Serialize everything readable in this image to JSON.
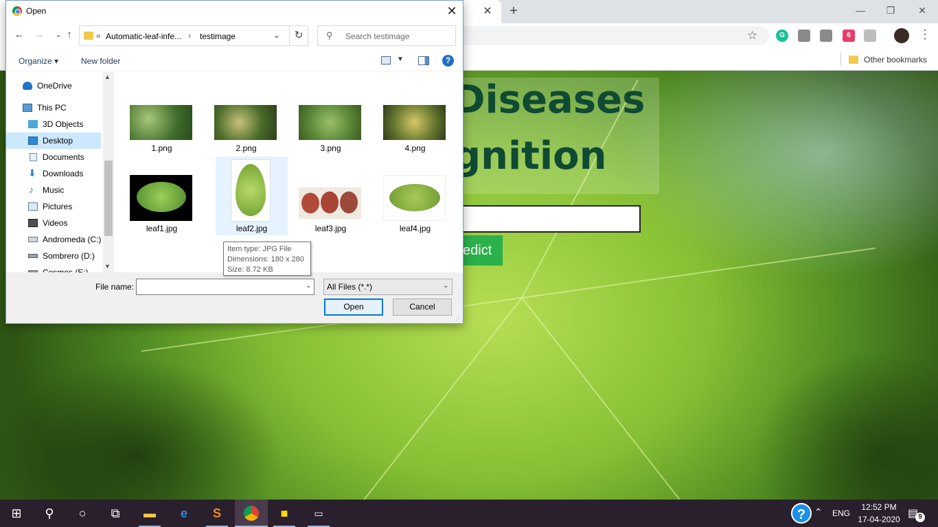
{
  "browser": {
    "tab_close": "✕",
    "new_tab": "+",
    "window_controls": {
      "minimize": "—",
      "restore": "❐",
      "close": "✕"
    },
    "extensions": [
      "G",
      "6"
    ],
    "other_bookmarks": "Other bookmarks"
  },
  "page": {
    "title_line1": "Diseases",
    "title_line2": "gnition",
    "predict_button": "edict"
  },
  "dialog": {
    "title": "Open",
    "close": "✕",
    "address": {
      "chevron": "«",
      "segment1": "Automatic-leaf-infe...",
      "separator": "›",
      "segment2": "testimage"
    },
    "search_placeholder": "Search testimage",
    "command_bar": {
      "organize": "Organize ▾",
      "new_folder": "New folder"
    },
    "nav_items": [
      {
        "label": "OneDrive",
        "icon": "onedrive-icon"
      },
      {
        "label": "This PC",
        "icon": "this-pc-icon"
      },
      {
        "label": "3D Objects",
        "icon": "3d-objects-icon"
      },
      {
        "label": "Desktop",
        "icon": "desktop-icon",
        "selected": true
      },
      {
        "label": "Documents",
        "icon": "documents-icon"
      },
      {
        "label": "Downloads",
        "icon": "downloads-icon"
      },
      {
        "label": "Music",
        "icon": "music-icon"
      },
      {
        "label": "Pictures",
        "icon": "pictures-icon"
      },
      {
        "label": "Videos",
        "icon": "videos-icon"
      },
      {
        "label": "Andromeda (C:)",
        "icon": "drive-c-icon"
      },
      {
        "label": "Sombrero (D:)",
        "icon": "drive-d-icon"
      },
      {
        "label": "Cosmos (E:)",
        "icon": "drive-e-icon"
      }
    ],
    "files": [
      {
        "name": "1.png"
      },
      {
        "name": "2.png"
      },
      {
        "name": "3.png"
      },
      {
        "name": "4.png"
      },
      {
        "name": "leaf1.jpg"
      },
      {
        "name": "leaf2.jpg",
        "hovered": true
      },
      {
        "name": "leaf3.jpg"
      },
      {
        "name": "leaf4.jpg"
      }
    ],
    "tooltip": {
      "type": "Item type: JPG File",
      "dimensions": "Dimensions: 180 x 280",
      "size": "Size: 8.72 KB"
    },
    "file_name_label": "File name:",
    "file_name_value": "",
    "file_type": "All Files (*.*)",
    "open_button": "Open",
    "cancel_button": "Cancel"
  },
  "taskbar": {
    "language": "ENG",
    "time": "12:52 PM",
    "date": "17-04-2020",
    "notification_count": "9"
  },
  "colors": {
    "accent": "#0078d7",
    "selection": "#cce8ff",
    "hover": "#e5f3ff",
    "predict_green": "#2bb04a",
    "title_green": "#0f4a33",
    "taskbar": "#2a1f2d"
  }
}
